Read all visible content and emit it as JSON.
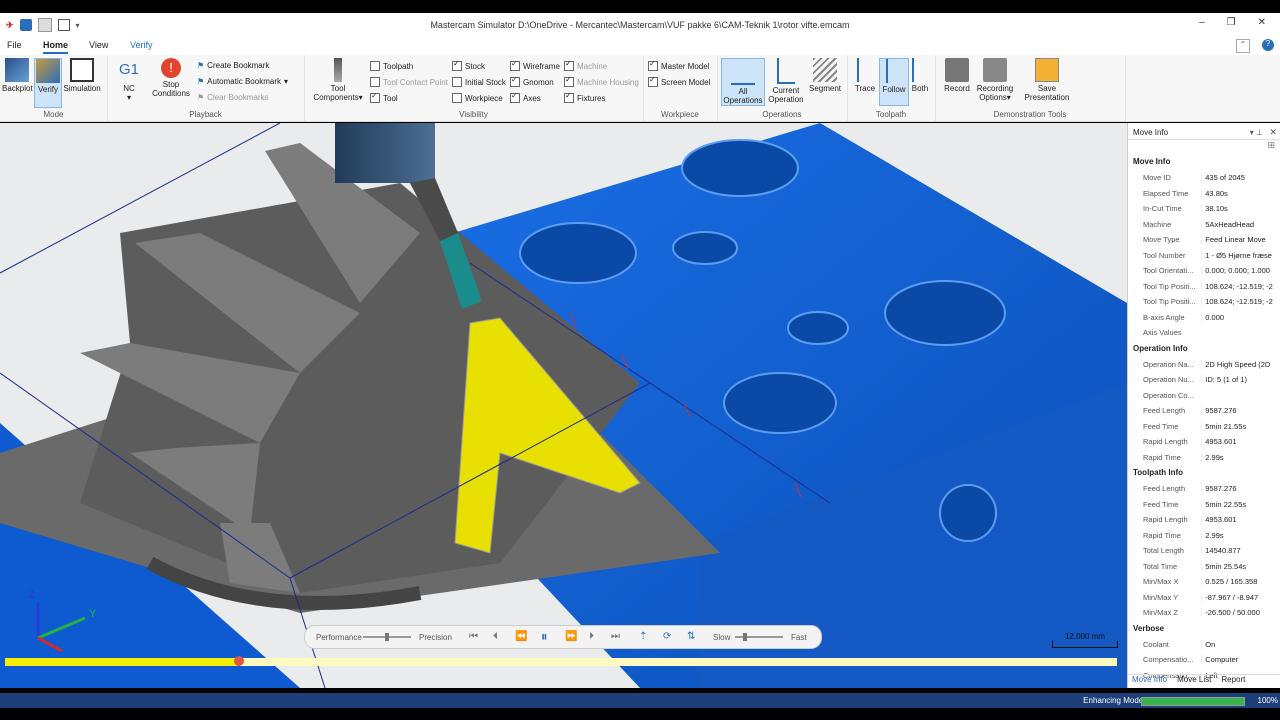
{
  "window": {
    "title": "Mastercam Simulator  D:\\OneDrive - Mercantec\\Mastercam\\VUF pakke 6\\CAM-Teknik 1\\rotor vifte.emcam",
    "min": "–",
    "max": "❐",
    "close": "✕"
  },
  "menu": {
    "file": "File",
    "home": "Home",
    "view": "View",
    "verify": "Verify"
  },
  "ribbon": {
    "mode": {
      "label": "Mode",
      "backplot": "Backplot",
      "verify": "Verify",
      "simulation": "Simulation"
    },
    "playback": {
      "label": "Playback",
      "nc_icon": "G1",
      "nc": "NC",
      "stop": "Stop",
      "conditions": "Conditions",
      "create_bookmark": "Create Bookmark",
      "automatic_bookmark": "Automatic Bookmark",
      "clear_bookmarks": "Clear Bookmarks"
    },
    "visibility": {
      "label": "Visibility",
      "tool": "Tool",
      "components": "Components",
      "toolpath": "Toolpath",
      "tool_contact_point": "Tool Contact Point",
      "tool_cb": "Tool",
      "stock": "Stock",
      "initial_stock": "Initial Stock",
      "workpiece": "Workpiece",
      "wireframe": "Wireframe",
      "gnomon": "Gnomon",
      "axes": "Axes",
      "machine": "Machine",
      "machine_housing": "Machine Housing",
      "fixtures": "Fixtures"
    },
    "workpiece": {
      "label": "Workpiece",
      "master_model": "Master Model",
      "screen_model": "Screen Model"
    },
    "operations": {
      "label": "Operations",
      "all": "All",
      "all2": "Operations",
      "current": "Current",
      "current2": "Operation",
      "segment": "Segment"
    },
    "toolpath": {
      "label": "Toolpath",
      "trace": "Trace",
      "follow": "Follow",
      "both": "Both"
    },
    "demo": {
      "label": "Demonstration Tools",
      "record": "Record",
      "recording": "Recording",
      "options": "Options",
      "save": "Save",
      "presentation": "Presentation"
    }
  },
  "playbar": {
    "performance": "Performance",
    "precision": "Precision",
    "slow": "Slow",
    "fast": "Fast",
    "progress": 0.21
  },
  "scale_label": "12.000 mm",
  "axes": {
    "z": "Z",
    "y": "Y"
  },
  "panel": {
    "title": "Move Info",
    "sections": [
      {
        "title": "Move Info",
        "rows": [
          [
            "Move ID",
            "435 of 2045"
          ],
          [
            "Elapsed Time",
            "43.80s"
          ],
          [
            "In-Cut Time",
            "38.10s"
          ],
          [
            "Machine",
            "5AxHeadHead"
          ],
          [
            "Move Type",
            "Feed Linear Move"
          ],
          [
            "Tool Number",
            "1 - Ø5 Hjørne fræse"
          ],
          [
            "Tool Orientati...",
            "0.000; 0.000; 1.000"
          ],
          [
            "Tool Tip Positi...",
            "108.624; -12.519; -2"
          ],
          [
            "Tool Tip Positi...",
            "108.624; -12.519; -2"
          ],
          [
            "B-axis Angle",
            "0.000"
          ],
          [
            "Axis Values",
            ""
          ]
        ]
      },
      {
        "title": "Operation Info",
        "rows": [
          [
            "Operation Na...",
            "2D High Speed (2D"
          ],
          [
            "Operation Nu...",
            "ID: 5 (1 of 1)"
          ],
          [
            "Operation Co...",
            ""
          ],
          [
            "Feed Length",
            "9587.276"
          ],
          [
            "Feed Time",
            "5min 21.55s"
          ],
          [
            "Rapid Length",
            "4953.601"
          ],
          [
            "Rapid Time",
            "2.99s"
          ]
        ]
      },
      {
        "title": "Toolpath Info",
        "rows": [
          [
            "Feed Length",
            "9587.276"
          ],
          [
            "Feed Time",
            "5min 22.55s"
          ],
          [
            "Rapid Length",
            "4953.601"
          ],
          [
            "Rapid Time",
            "2.99s"
          ],
          [
            "Total Length",
            "14540.877"
          ],
          [
            "Total Time",
            "5min 25.54s"
          ],
          [
            "Min/Max X",
            "0.525 / 165.358"
          ],
          [
            "Min/Max Y",
            "-87.967 / -8.947"
          ],
          [
            "Min/Max Z",
            "-26.500 / 50.000"
          ]
        ]
      },
      {
        "title": "Verbose",
        "rows": [
          [
            "Coolant",
            "On"
          ],
          [
            "Compensatio...",
            "Computer"
          ],
          [
            "Compensatio...",
            "Left"
          ]
        ]
      }
    ],
    "tabs": [
      "Move Info",
      "Move List",
      "Report"
    ]
  },
  "status": {
    "text": "Enhancing Model",
    "percent_label": "100%",
    "progress": 1.0
  }
}
